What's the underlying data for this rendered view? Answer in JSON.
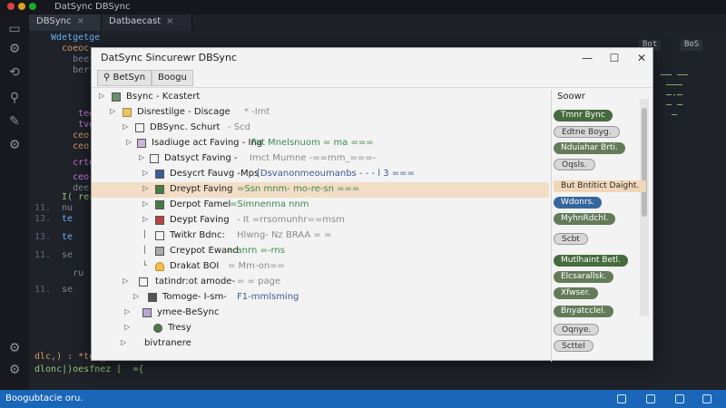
{
  "window": {
    "title": "DatSync DBSync"
  },
  "tabs": [
    {
      "label": "DBSync"
    },
    {
      "label": "Datbaecast"
    }
  ],
  "editor": {
    "left_lines": [
      {
        "n": "",
        "code": "Wdetgetge"
      },
      {
        "n": "",
        "code": "  coeoc"
      },
      {
        "n": "",
        "code": "    beet"
      },
      {
        "n": "",
        "code": "    bert"
      },
      {
        "n": "",
        "code": "     tee"
      },
      {
        "n": "",
        "code": "     tvo"
      },
      {
        "n": "",
        "code": "    ceo"
      },
      {
        "n": "",
        "code": "    ceo"
      },
      {
        "n": "",
        "code": "    crte"
      },
      {
        "n": "",
        "code": "    ceo"
      },
      {
        "n": "",
        "code": "    dee"
      },
      {
        "n": "",
        "code": "  I( rer"
      },
      {
        "n": "11.",
        "code": "  nu"
      },
      {
        "n": "13.",
        "code": "  te"
      },
      {
        "n": "13.",
        "code": "  te"
      },
      {
        "n": "11.",
        "code": "  se"
      },
      {
        "n": "",
        "code": "    ru"
      },
      {
        "n": "11.",
        "code": "  se"
      }
    ],
    "bottom_lines": [
      {
        "code": "dlc,) : *tos_ {"
      },
      {
        "code": "dlonc|)oesfnez [  ={"
      }
    ],
    "right_buttons": [
      {
        "label": "Bot"
      },
      {
        "label": "BoS"
      }
    ]
  },
  "statusbar": {
    "left_text": "Boogubtacie  oru."
  },
  "dialog": {
    "title": "DatSync Sincurewr DBSync",
    "toolbar": {
      "btn1": "BetSyn",
      "btn2": "Boogu"
    },
    "tree": [
      {
        "label": "Bsync - Kcastert",
        "extra": "",
        "extra_class": ""
      },
      {
        "label": "Disrestilge - Discage",
        "extra": "* -Imt",
        "extra_class": ""
      },
      {
        "label": "DBSync. Schurt",
        "extra": "- Scd",
        "extra_class": ""
      },
      {
        "label": "Isadiuge act Faving - Ing",
        "extra": "Fat Mnelsnuom = ma ===",
        "extra_class": "g"
      },
      {
        "label": "Datsyct Faving -",
        "extra": "Imct Mumne -==mm_===-",
        "extra_class": ""
      },
      {
        "label": "Desycrt Fauvg -Mps",
        "extra": "[Dsvanonmeoumanbs - - -  l  3 ===",
        "extra_class": "b"
      },
      {
        "label": "Dreypt Faving",
        "extra": "=Ssn mnm- mo-re-sn ===",
        "extra_class": "g"
      },
      {
        "label": "Derpot Famel",
        "extra": "=Simnenma nnm",
        "extra_class": "g"
      },
      {
        "label": "Deypt Faving",
        "extra": "- It =rrsomunhr==msm",
        "extra_class": ""
      },
      {
        "label": "Twitkr Bdnc:",
        "extra": "Hlwng- Nz BRAA = =",
        "extra_class": ""
      },
      {
        "label": "Creypot Ewand",
        "extra": "= anrn =-rns",
        "extra_class": "g"
      },
      {
        "label": "Drakat BOI",
        "extra": "= Mm-on==",
        "extra_class": ""
      },
      {
        "label": "tatindr:ot amode-",
        "extra": "= = page",
        "extra_class": ""
      },
      {
        "label": "Tomoge- I-sm-",
        "extra": "F1-mmlsming",
        "extra_class": "b"
      },
      {
        "label": "ymee-BeSync",
        "extra": "",
        "extra_class": ""
      },
      {
        "label": "Tresy",
        "extra": "",
        "extra_class": ""
      },
      {
        "label": "bivtranere",
        "extra": "",
        "extra_class": ""
      }
    ],
    "right_panel": {
      "header": "Soowr",
      "tags": [
        {
          "label": "Tmnr Bync",
          "style": "dg"
        },
        {
          "label": "Edtne Boyg.",
          "style": "lg"
        },
        {
          "label": "Nduiahar Brti.",
          "style": "mg"
        },
        {
          "label": "Oqsls.",
          "style": "lg"
        },
        {
          "label": "But Bntitict Daight.",
          "style": "hl"
        },
        {
          "label": "Wdonrs.",
          "style": "bl"
        },
        {
          "label": "MyhnRdchl.",
          "style": "mg"
        },
        {
          "label": "Scbt",
          "style": "lg"
        },
        {
          "label": "Mutlhaint Betl.",
          "style": "dg"
        },
        {
          "label": "Elcsarallsk.",
          "style": "mg"
        },
        {
          "label": "Xfwser.",
          "style": "mg"
        },
        {
          "label": "Bnyatcclel.",
          "style": "mg"
        },
        {
          "label": "Oqnye.",
          "style": "lg"
        },
        {
          "label": "Scttel",
          "style": "lg"
        }
      ]
    }
  }
}
